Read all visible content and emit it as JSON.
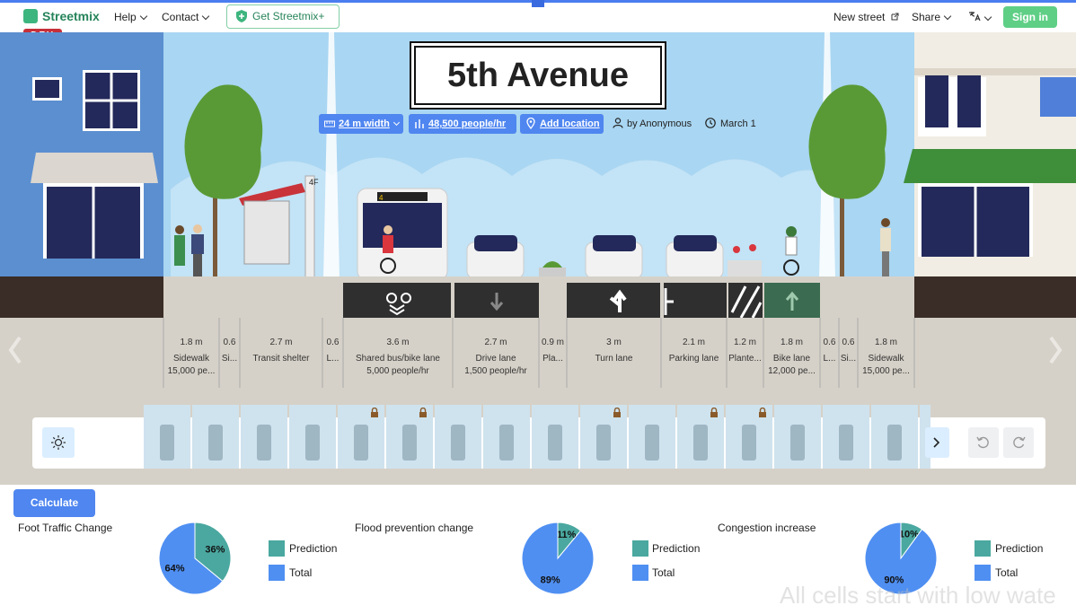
{
  "header": {
    "brand": "Streetmix",
    "env_badge": "DEV",
    "nav": [
      {
        "label": "Help"
      },
      {
        "label": "Contact"
      }
    ],
    "get_plus": "Get Streetmix+",
    "new_street": "New street",
    "share": "Share",
    "sign_in": "Sign in"
  },
  "street": {
    "title": "5th Avenue",
    "width": "24 m width",
    "capacity": "48,500 people/hr",
    "location": "Add location",
    "author": "by Anonymous",
    "date": "March 1"
  },
  "segments": [
    {
      "width": "1.8 m",
      "name": "Sidewalk",
      "cap": "15,000 pe..."
    },
    {
      "width": "0.6",
      "name": "Si...",
      "cap": ""
    },
    {
      "width": "2.7 m",
      "name": "Transit shelter",
      "cap": ""
    },
    {
      "width": "0.6",
      "name": "L...",
      "cap": ""
    },
    {
      "width": "3.6 m",
      "name": "Shared bus/bike lane",
      "cap": "5,000 people/hr"
    },
    {
      "width": "2.7 m",
      "name": "Drive lane",
      "cap": "1,500 people/hr"
    },
    {
      "width": "0.9 m",
      "name": "Pla...",
      "cap": ""
    },
    {
      "width": "3 m",
      "name": "Turn lane",
      "cap": ""
    },
    {
      "width": "2.1 m",
      "name": "Parking lane",
      "cap": ""
    },
    {
      "width": "1.2 m",
      "name": "Plante...",
      "cap": ""
    },
    {
      "width": "1.8 m",
      "name": "Bike lane",
      "cap": "12,000 pe..."
    },
    {
      "width": "0.6",
      "name": "L...",
      "cap": ""
    },
    {
      "width": "0.6",
      "name": "Si...",
      "cap": ""
    },
    {
      "width": "1.8 m",
      "name": "Sidewalk",
      "cap": "15,000 pe..."
    }
  ],
  "bus_sign": "4",
  "shelter_sign": "4F",
  "palette": {
    "items": [
      "people",
      "tree",
      "bicycle-rack",
      "bench",
      "cafe-seating",
      "kiosk",
      "lamp",
      "utility-pole",
      "planter-box",
      "vendor",
      "flowers",
      "cone",
      "wayfinding",
      "bike-rider",
      "scooter",
      "cyclist",
      "more"
    ],
    "locked": [
      4,
      5,
      9,
      11,
      12
    ]
  },
  "calculate": "Calculate",
  "charts": [
    {
      "title": "Foot Traffic Change",
      "slices": [
        {
          "label": "36%",
          "value": 36,
          "series": "Prediction"
        },
        {
          "label": "64%",
          "value": 64,
          "series": "Total"
        }
      ]
    },
    {
      "title": "Flood prevention change",
      "slices": [
        {
          "label": "11%",
          "value": 11,
          "series": "Prediction"
        },
        {
          "label": "89%",
          "value": 89,
          "series": "Total"
        }
      ]
    },
    {
      "title": "Congestion increase",
      "slices": [
        {
          "label": "10%",
          "value": 10,
          "series": "Prediction"
        },
        {
          "label": "90%",
          "value": 90,
          "series": "Total"
        }
      ]
    }
  ],
  "legend": {
    "prediction": "Prediction",
    "total": "Total"
  },
  "chart_data": [
    {
      "type": "pie",
      "title": "Foot Traffic Change",
      "categories": [
        "Prediction",
        "Total"
      ],
      "values": [
        36,
        64
      ]
    },
    {
      "type": "pie",
      "title": "Flood prevention change",
      "categories": [
        "Prediction",
        "Total"
      ],
      "values": [
        11,
        89
      ]
    },
    {
      "type": "pie",
      "title": "Congestion increase",
      "categories": [
        "Prediction",
        "Total"
      ],
      "values": [
        10,
        90
      ]
    }
  ],
  "colors": {
    "prediction": "#4aa8a0",
    "total": "#4f8ff2",
    "accent": "#4f86f0",
    "brand": "#3db57e"
  },
  "watermark": "All cells start with low wate"
}
